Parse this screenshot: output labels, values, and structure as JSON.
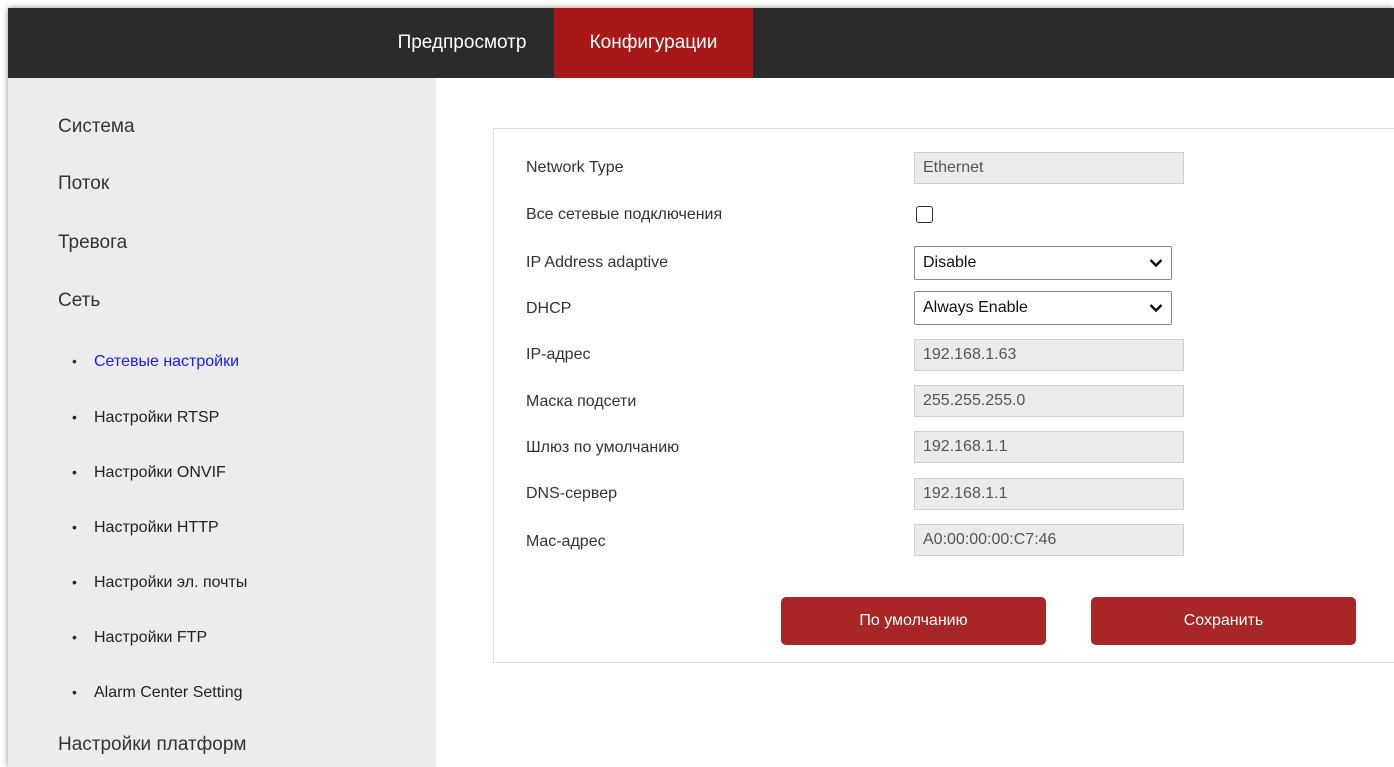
{
  "header": {
    "tabs": [
      {
        "label": "Предпросмотр",
        "active": false
      },
      {
        "label": "Конфигурации",
        "active": true
      }
    ]
  },
  "sidebar": {
    "categories": {
      "system": "Система",
      "stream": "Поток",
      "alarm": "Тревога",
      "network": "Сеть",
      "platform": "Настройки платформ"
    },
    "network_items": [
      {
        "label": "Сетевые настройки",
        "active": true
      },
      {
        "label": "Настройки RTSP",
        "active": false
      },
      {
        "label": "Настройки ONVIF",
        "active": false
      },
      {
        "label": "Настройки HTTP",
        "active": false
      },
      {
        "label": "Настройки эл. почты",
        "active": false
      },
      {
        "label": "Настройки FTP",
        "active": false
      },
      {
        "label": "Alarm Center Setting",
        "active": false
      }
    ],
    "bullet": "•"
  },
  "form": {
    "network_type": {
      "label": "Network Type",
      "value": "Ethernet"
    },
    "all_connections": {
      "label": "Все сетевые подключения",
      "checked": false
    },
    "ip_adaptive": {
      "label": "IP Address adaptive",
      "value": "Disable"
    },
    "dhcp": {
      "label": "DHCP",
      "value": "Always Enable"
    },
    "ip_address": {
      "label": "IP-адрес",
      "value": "192.168.1.63"
    },
    "subnet_mask": {
      "label": "Маска подсети",
      "value": "255.255.255.0"
    },
    "gateway": {
      "label": "Шлюз по умолчанию",
      "value": "192.168.1.1"
    },
    "dns": {
      "label": "DNS-сервер",
      "value": "192.168.1.1"
    },
    "mac": {
      "label": "Mac-адрес",
      "value": "A0:00:00:00:C7:46"
    }
  },
  "buttons": {
    "default_label": "По умолчанию",
    "save_label": "Сохранить"
  },
  "colors": {
    "accent": "#a81818",
    "button": "#a82626",
    "topbar": "#2b2b2b",
    "sidebar": "#ececec",
    "active_link": "#1a1aff"
  }
}
